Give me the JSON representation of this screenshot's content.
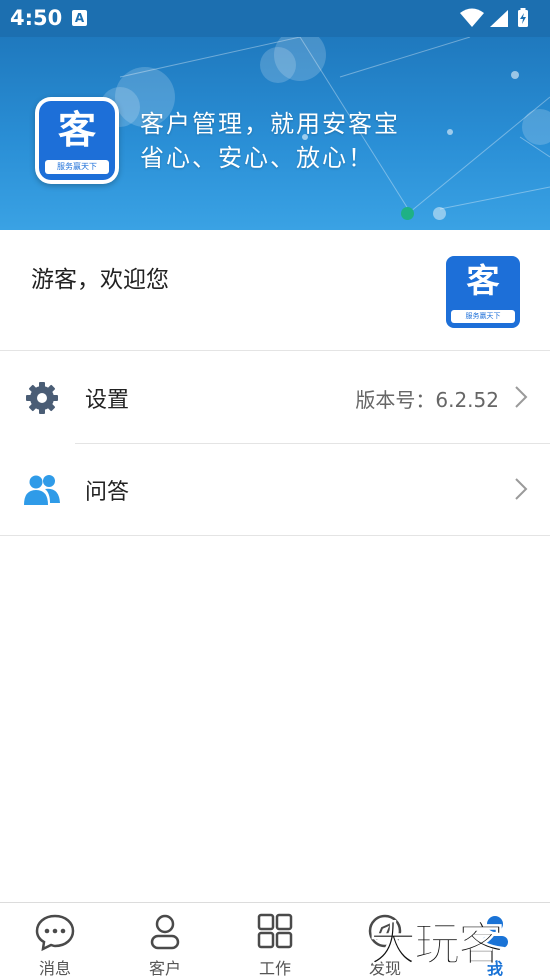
{
  "status_bar": {
    "time": "4:50",
    "notification_letter": "A",
    "icons": [
      "wifi-icon",
      "signal-icon",
      "battery-icon"
    ]
  },
  "banner": {
    "slogan_line1": "客户管理，就用安客宝",
    "slogan_line2": "省心、安心、放心！",
    "logo_glyph": "客",
    "logo_subtext": "服务赢天下",
    "active_dot_color": "#1fb185"
  },
  "welcome": {
    "text": "游客，欢迎您",
    "logo_glyph": "客",
    "logo_subtext": "服务赢天下"
  },
  "menu": {
    "settings": {
      "label": "设置",
      "value": "版本号：6.2.52",
      "icon": "gear-icon"
    },
    "qa": {
      "label": "问答",
      "icon": "users-icon"
    }
  },
  "bottom_nav": {
    "items": [
      {
        "label": "消息",
        "icon": "chat-bubble-icon",
        "active": false
      },
      {
        "label": "客户",
        "icon": "person-icon",
        "active": false
      },
      {
        "label": "工作",
        "icon": "grid-icon",
        "active": false
      },
      {
        "label": "发现",
        "icon": "compass-icon",
        "active": false
      },
      {
        "label": "我",
        "icon": "me-icon",
        "active": true
      }
    ]
  },
  "watermark": "大玩客",
  "colors": {
    "status_bar": "#1c6fb0",
    "banner": "#2a8fd6",
    "brand_blue": "#1d6fd8",
    "nav_active": "#1a73d6",
    "icon_gray": "#4a5d75",
    "qa_icon": "#2f9be8"
  }
}
